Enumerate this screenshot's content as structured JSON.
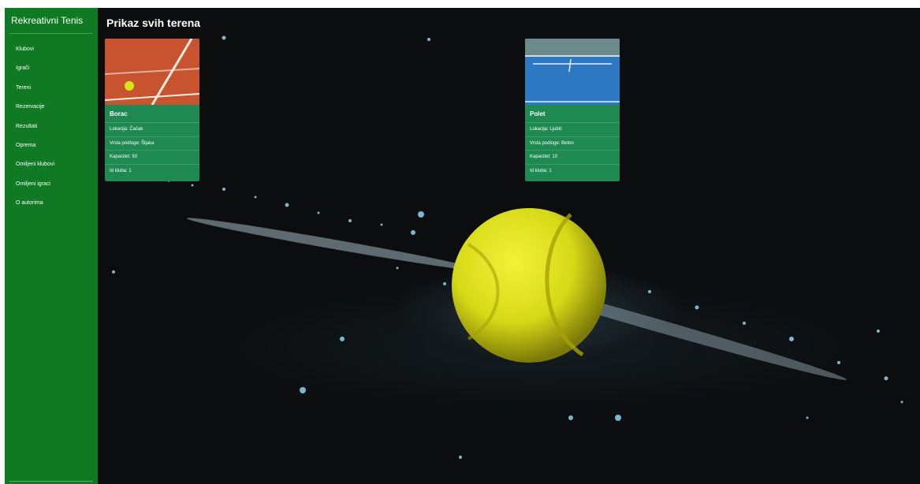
{
  "sidebar": {
    "brand": "Rekreativni Tenis",
    "items": [
      {
        "label": "Klubovi"
      },
      {
        "label": "Igrači"
      },
      {
        "label": "Tereni"
      },
      {
        "label": "Rezervacije"
      },
      {
        "label": "Rezultati"
      },
      {
        "label": "Oprema"
      },
      {
        "label": "Omiljeni klubovi"
      },
      {
        "label": "Omiljeni igraci"
      },
      {
        "label": "O autorima"
      }
    ]
  },
  "main": {
    "title": "Prikaz svih terena",
    "cards": [
      {
        "name": "Borac",
        "location": "Lokacija: Čačak",
        "surface": "Vrsta podloge: Šljaka",
        "capacity": "Kapacitet: 50",
        "club_id": "Id kluba: 1"
      },
      {
        "name": "Polet",
        "location": "Lokacija: Ljubić",
        "surface": "Vrsta podloge: Beton",
        "capacity": "Kapacitet: 10",
        "club_id": "Id kluba: 1"
      }
    ]
  },
  "colors": {
    "sidebar": "#0f7a23",
    "card": "#1e8a52",
    "background": "#0b0d0e",
    "ball": "#d9e01a"
  }
}
